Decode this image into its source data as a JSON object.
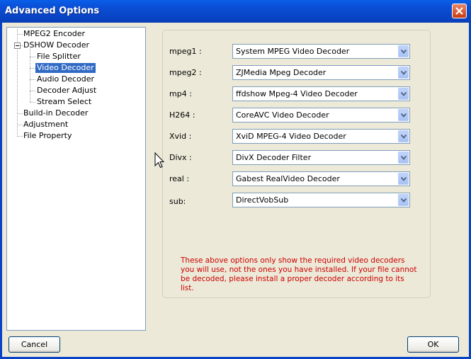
{
  "window": {
    "title": "Advanced Options"
  },
  "tree": {
    "items": [
      {
        "label": "MPEG2 Encoder"
      },
      {
        "label": "DSHOW Decoder"
      },
      {
        "label": "File Splitter"
      },
      {
        "label": "Video Decoder"
      },
      {
        "label": "Audio Decoder"
      },
      {
        "label": "Decoder Adjust"
      },
      {
        "label": "Stream Select"
      },
      {
        "label": "Build-in Decoder"
      },
      {
        "label": "Adjustment"
      },
      {
        "label": "File Property"
      }
    ],
    "selected": "Video Decoder"
  },
  "decoders": [
    {
      "label": "mpeg1 :",
      "value": "System MPEG Video Decoder"
    },
    {
      "label": "mpeg2 :",
      "value": "ZJMedia Mpeg Decoder"
    },
    {
      "label": "mp4 :",
      "value": "ffdshow Mpeg-4 Video Decoder"
    },
    {
      "label": "H264 :",
      "value": "CoreAVC Video Decoder"
    },
    {
      "label": "Xvid :",
      "value": "XviD MPEG-4 Video Decoder"
    },
    {
      "label": "Divx :",
      "value": "DivX Decoder Filter"
    },
    {
      "label": "real :",
      "value": "Gabest RealVideo Decoder"
    },
    {
      "label": "sub:",
      "value": "DirectVobSub"
    }
  ],
  "note": "These above options only show the required video decoders you will use, not the ones you have installed. If your file cannot be decoded, please install a proper decoder according to its list.",
  "buttons": {
    "cancel": "Cancel",
    "ok": "OK"
  },
  "colors": {
    "titlebar": "#0b4fd7",
    "selection": "#316ac5",
    "note": "#cc0000",
    "face": "#ece9d8"
  }
}
